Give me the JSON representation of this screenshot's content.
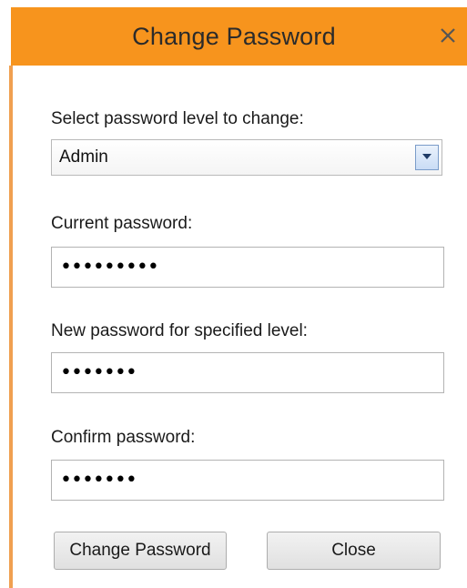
{
  "window": {
    "title": "Change Password",
    "accent_color": "#f7941d"
  },
  "level": {
    "label": "Select password level to change:",
    "selected": "Admin"
  },
  "current_password": {
    "label": "Current password:",
    "masked_value": "•••••••••"
  },
  "new_password": {
    "label": "New password for specified level:",
    "masked_value": "•••••••"
  },
  "confirm_password": {
    "label": "Confirm password:",
    "masked_value": "•••••••"
  },
  "buttons": {
    "change_label": "Change Password",
    "close_label": "Close"
  },
  "icons": {
    "close": "close-icon",
    "dropdown": "chevron-down-icon"
  }
}
